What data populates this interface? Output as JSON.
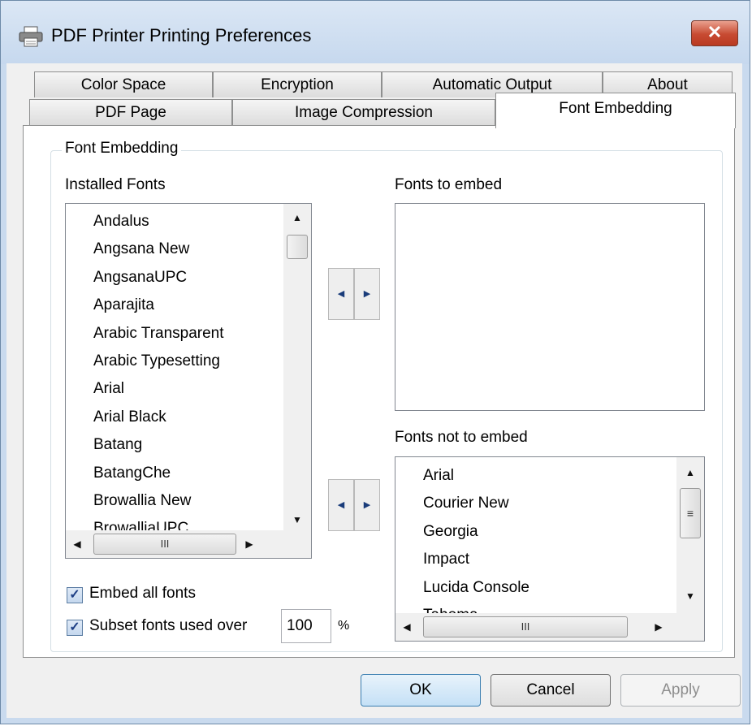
{
  "window": {
    "title": "PDF Printer Printing Preferences",
    "close_glyph": "✕"
  },
  "tabs_row_back": [
    {
      "label": "Color Space"
    },
    {
      "label": "Encryption"
    },
    {
      "label": "Automatic Output"
    },
    {
      "label": "About"
    }
  ],
  "tabs_row_front": [
    {
      "label": "PDF Page"
    },
    {
      "label": "Image Compression"
    },
    {
      "label": "Font Embedding",
      "active": true
    }
  ],
  "group": {
    "label": "Font Embedding"
  },
  "installed": {
    "label": "Installed Fonts",
    "items": [
      "Andalus",
      "Angsana New",
      "AngsanaUPC",
      "Aparajita",
      "Arabic Transparent",
      "Arabic Typesetting",
      "Arial",
      "Arial Black",
      "Batang",
      "BatangChe",
      "Browallia New",
      "BrowalliaUPC"
    ]
  },
  "embed": {
    "label": "Fonts to embed",
    "items": []
  },
  "not_embed": {
    "label": "Fonts not to embed",
    "items": [
      "Arial",
      "Courier New",
      "Georgia",
      "Impact",
      "Lucida Console",
      "Tahoma"
    ]
  },
  "options": {
    "embed_all_label": "Embed all fonts",
    "embed_all_checked": true,
    "subset_label": "Subset fonts used over",
    "subset_checked": true,
    "subset_value": "100",
    "subset_unit": "%"
  },
  "scroll": {
    "grip": "III",
    "vgrip": "≡"
  },
  "buttons": {
    "ok": "OK",
    "cancel": "Cancel",
    "apply": "Apply"
  },
  "colors": {
    "title_bar": "#c9daee",
    "close_button": "#c74a31",
    "default_button": "#3c7fb1"
  },
  "icons": {
    "title": "printer-icon",
    "left": "arrow-left-icon",
    "right": "arrow-right-icon",
    "up": "arrow-up-icon",
    "down": "arrow-down-icon"
  }
}
